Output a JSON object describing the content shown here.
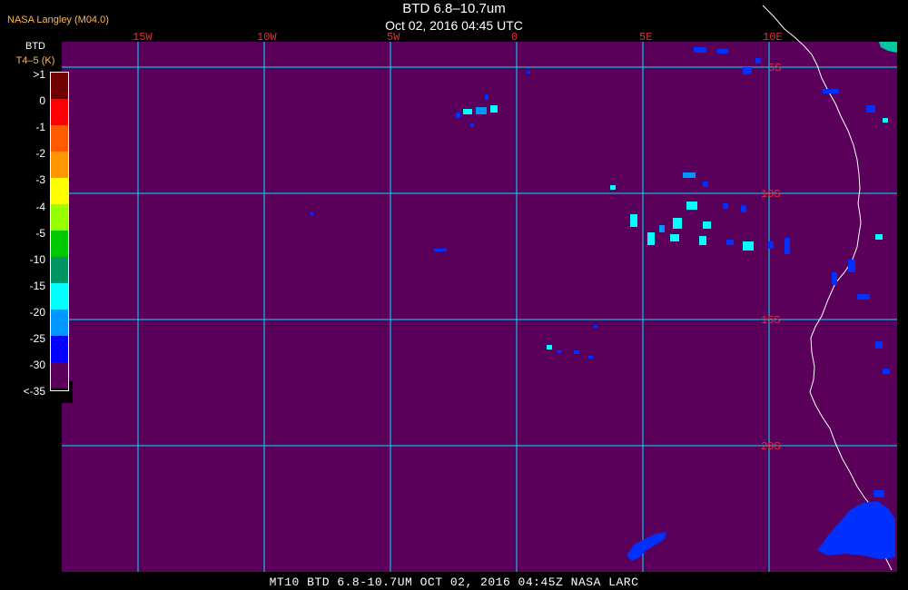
{
  "header": {
    "credit": "NASA Langley (M04.0)",
    "title": "BTD 6.8–10.7um",
    "datetime": "Oct 02, 2016 04:45 UTC"
  },
  "legend": {
    "title": "BTD",
    "units": "T4–5 (K)",
    "labels": [
      ">1",
      "0",
      "-1",
      "-2",
      "-3",
      "-4",
      "-5",
      "-10",
      "-15",
      "-20",
      "-25",
      "-30",
      "<-35"
    ],
    "colors": [
      "#6e0000",
      "#ff0000",
      "#ff5a00",
      "#ff9600",
      "#ffff00",
      "#96ff00",
      "#00c800",
      "#009664",
      "#00ffff",
      "#0096ff",
      "#0000ff",
      "#5a005a"
    ]
  },
  "map": {
    "background": "#5a005a",
    "grid_color": "#00e0ff",
    "label_color": "#e0303a",
    "lon_labels": [
      "15W",
      "10W",
      "5W",
      "0",
      "5E",
      "10E"
    ],
    "lat_labels": [
      "5S",
      "10S",
      "15S",
      "20S"
    ]
  },
  "footer": "MT10  BTD 6.8-10.7UM   OCT 02, 2016 04:45Z   NASA LARC"
}
